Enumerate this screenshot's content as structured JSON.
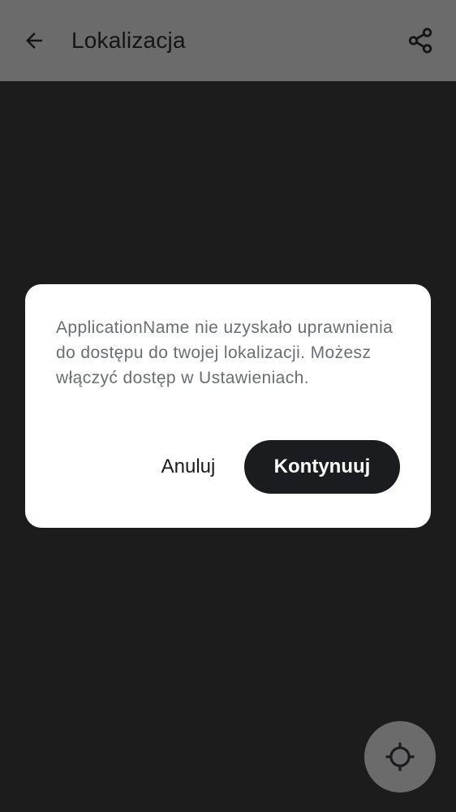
{
  "app_bar": {
    "title": "Lokalizacja",
    "back_icon": "arrow-back-icon",
    "share_icon": "share-icon"
  },
  "dialog": {
    "message": "ApplicationName nie uzyskało uprawnienia do dostępu do twojej lokalizacji. Możesz włączyć dostęp w Ustawieniach.",
    "cancel_label": "Anuluj",
    "confirm_label": "Kontynuuj"
  },
  "fab": {
    "icon": "my-location-icon"
  },
  "colors": {
    "background": "#1c1c1d",
    "scrim_app_bar": "#6b6b6c",
    "dialog_surface": "#ffffff",
    "primary_button": "#1b1c20",
    "message_text": "#6a6e72"
  }
}
